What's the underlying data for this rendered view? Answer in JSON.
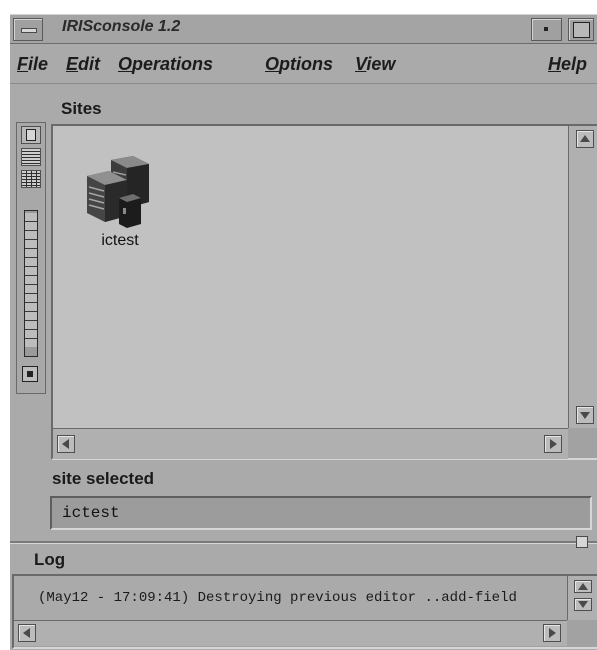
{
  "window": {
    "title": "IRISconsole 1.2"
  },
  "menubar": {
    "items": [
      {
        "first": "F",
        "rest": "ile"
      },
      {
        "first": "E",
        "rest": "dit"
      },
      {
        "first": "O",
        "rest": "perations"
      },
      {
        "first": "O",
        "rest": "ptions"
      },
      {
        "first": "V",
        "rest": "iew"
      },
      {
        "first": "H",
        "rest": "elp"
      }
    ]
  },
  "sites": {
    "label": "Sites",
    "items": [
      {
        "name": "ictest",
        "icon": "server-icon"
      }
    ]
  },
  "selection": {
    "label": "site selected",
    "value": "ictest"
  },
  "log": {
    "label": "Log",
    "message": "(May12 - 17:09:41) Destroying previous editor ..add-field"
  },
  "colors": {
    "window_bg": "#aaaaaa",
    "canvas_bg": "#c1c1c1"
  }
}
